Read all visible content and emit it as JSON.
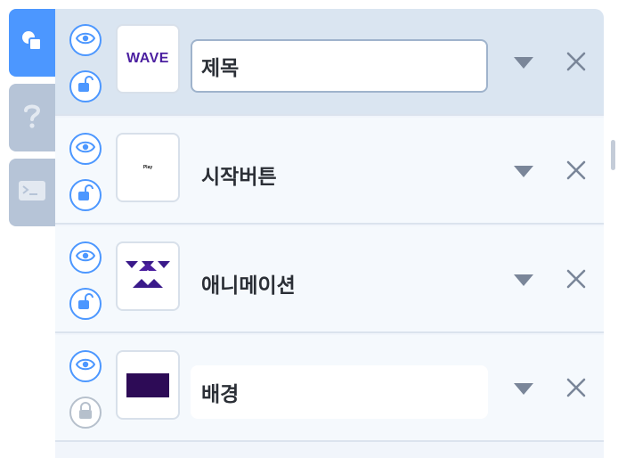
{
  "rail": {
    "tabs": [
      {
        "icon": "objects-icon",
        "active": true
      },
      {
        "icon": "help-icon",
        "active": false
      },
      {
        "icon": "console-icon",
        "active": false
      }
    ]
  },
  "objects": [
    {
      "name": "제목",
      "thumbnail_text": "WAVE",
      "visible": true,
      "locked": false,
      "selected": true
    },
    {
      "name": "시작버튼",
      "thumbnail_text": "Play",
      "visible": true,
      "locked": false,
      "selected": false
    },
    {
      "name": "애니메이션",
      "thumbnail_text": "",
      "visible": true,
      "locked": false,
      "selected": false
    },
    {
      "name": "배경",
      "thumbnail_text": "",
      "visible": true,
      "locked": true,
      "selected": false
    }
  ],
  "colors": {
    "accent": "#4c97ff",
    "selected_row": "#dae5f1",
    "rail_inactive": "#b6c4d7",
    "icon_gray": "#7a8699"
  }
}
